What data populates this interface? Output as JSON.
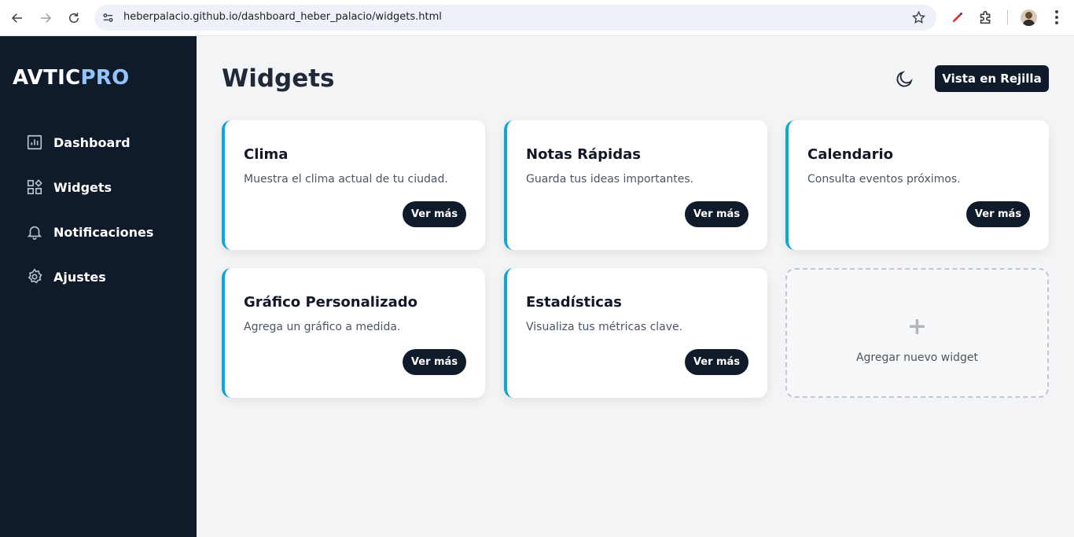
{
  "browser": {
    "url": "heberpalacio.github.io/dashboard_heber_palacio/widgets.html"
  },
  "sidebar": {
    "logo_part1": "AVTIC",
    "logo_part2": "PRO",
    "items": [
      {
        "label": "Dashboard",
        "icon": "bar-chart-icon"
      },
      {
        "label": "Widgets",
        "icon": "widgets-icon"
      },
      {
        "label": "Notificaciones",
        "icon": "bell-icon"
      },
      {
        "label": "Ajustes",
        "icon": "gear-icon"
      }
    ]
  },
  "header": {
    "title": "Widgets",
    "view_button": "Vista en Rejilla"
  },
  "cards": [
    {
      "title": "Clima",
      "desc": "Muestra el clima actual de tu ciudad.",
      "button": "Ver más"
    },
    {
      "title": "Notas Rápidas",
      "desc": "Guarda tus ideas importantes.",
      "button": "Ver más"
    },
    {
      "title": "Calendario",
      "desc": "Consulta eventos próximos.",
      "button": "Ver más"
    },
    {
      "title": "Gráfico Personalizado",
      "desc": "Agrega un gráfico a medida.",
      "button": "Ver más"
    },
    {
      "title": "Estadísticas",
      "desc": "Visualiza tus métricas clave.",
      "button": "Ver más"
    }
  ],
  "add_widget": {
    "plus": "+",
    "label": "Agregar nuevo widget"
  },
  "colors": {
    "sidebar_bg": "#0f1b2b",
    "accent": "#0ea5d7",
    "logo_accent": "#93c5fd"
  }
}
